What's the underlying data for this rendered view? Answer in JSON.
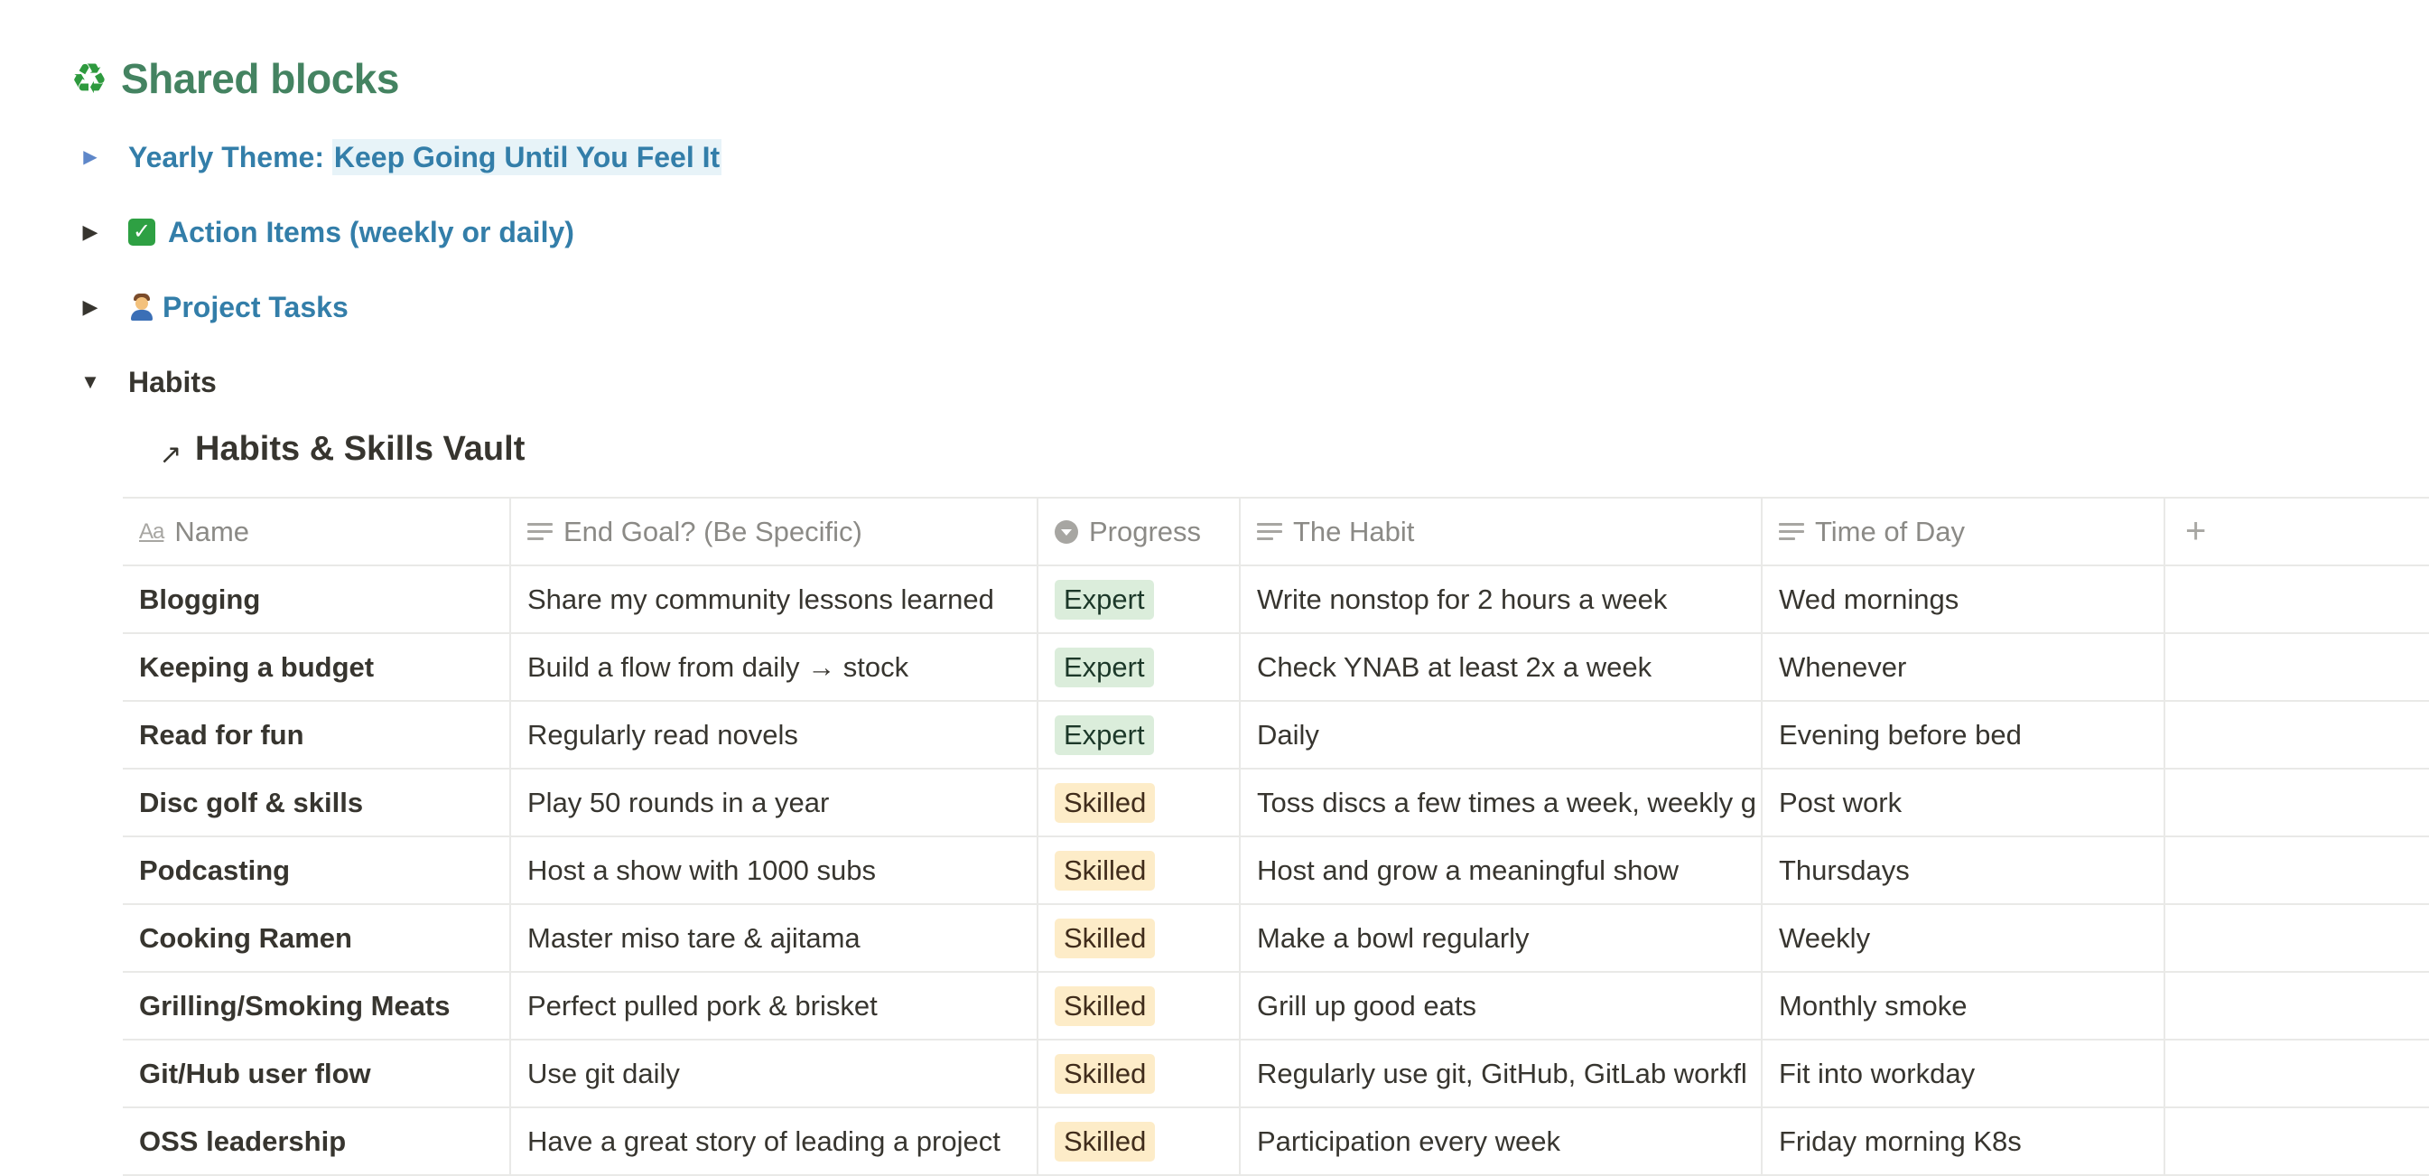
{
  "heading": {
    "icon": "recycle-icon",
    "title": "Shared blocks"
  },
  "toggles": [
    {
      "label_prefix": "Yearly Theme: ",
      "label_highlight": "Keep Going Until You Feel It",
      "state": "collapsed"
    },
    {
      "emoji": "check-mark-emoji",
      "label": "Action Items (weekly or daily)",
      "state": "collapsed"
    },
    {
      "emoji": "construction-worker-emoji",
      "label": "Project Tasks",
      "state": "collapsed"
    },
    {
      "label": "Habits",
      "state": "expanded"
    }
  ],
  "database": {
    "title": "Habits & Skills Vault",
    "columns": [
      {
        "label": "Name",
        "icon": "title-property-icon"
      },
      {
        "label": "End Goal? (Be Specific)",
        "icon": "text-property-icon"
      },
      {
        "label": "Progress",
        "icon": "select-property-icon"
      },
      {
        "label": "The Habit",
        "icon": "text-property-icon"
      },
      {
        "label": "Time of Day",
        "icon": "text-property-icon"
      }
    ],
    "add_column": "+",
    "rows": [
      {
        "name": "Blogging",
        "goal": "Share my community lessons learned",
        "progress": "Expert",
        "habit": "Write nonstop for 2 hours a week",
        "time": "Wed mornings"
      },
      {
        "name": "Keeping a budget",
        "goal": "Build a flow from daily → stock",
        "progress": "Expert",
        "habit": "Check YNAB at least 2x a week",
        "time": "Whenever"
      },
      {
        "name": "Read for fun",
        "goal": "Regularly read novels",
        "progress": "Expert",
        "habit": "Daily",
        "time": "Evening before bed"
      },
      {
        "name": "Disc golf & skills",
        "goal": "Play 50 rounds in a year",
        "progress": "Skilled",
        "habit": "Toss discs a few times a week, weekly g",
        "time": "Post work"
      },
      {
        "name": "Podcasting",
        "goal": "Host a show with 1000 subs",
        "progress": "Skilled",
        "habit": "Host and grow a meaningful show",
        "time": "Thursdays"
      },
      {
        "name": "Cooking Ramen",
        "goal": "Master miso tare & ajitama",
        "progress": "Skilled",
        "habit": "Make a bowl regularly",
        "time": "Weekly"
      },
      {
        "name": "Grilling/Smoking Meats",
        "goal": "Perfect pulled pork & brisket",
        "progress": "Skilled",
        "habit": "Grill up good eats",
        "time": "Monthly smoke"
      },
      {
        "name": "Git/Hub user flow",
        "goal": "Use git daily",
        "progress": "Skilled",
        "habit": "Regularly use git, GitHub, GitLab workfl",
        "time": "Fit into workday"
      },
      {
        "name": "OSS leadership",
        "goal": "Have a great story of leading a project",
        "progress": "Skilled",
        "habit": "Participation every week",
        "time": "Friday morning K8s"
      }
    ]
  },
  "colors": {
    "heading_green": "#448361",
    "link_blue": "#337ea9",
    "expert_tag_bg": "#dbeddb",
    "skilled_tag_bg": "#fdecc8"
  }
}
